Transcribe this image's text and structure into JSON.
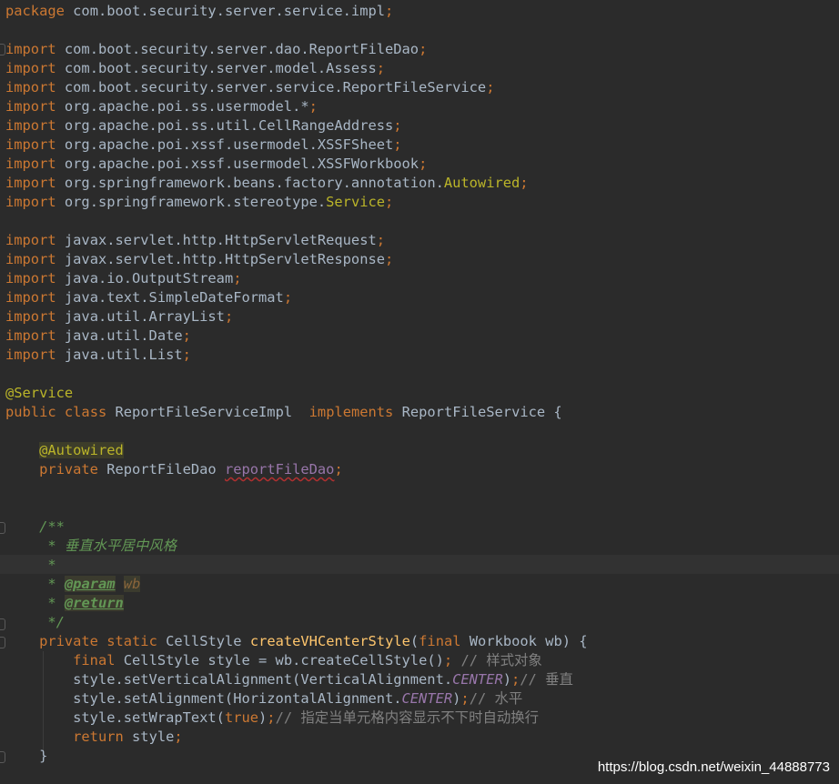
{
  "code": {
    "package_kw": "package",
    "package_name": "com.boot.security.server.service.impl",
    "semi": ";",
    "import_kw": "import",
    "imports_a": [
      {
        "path": "com.boot.security.server.dao.ReportFileDao",
        "tail": ""
      },
      {
        "path": "com.boot.security.server.model.Assess",
        "tail": ""
      },
      {
        "path": "com.boot.security.server.service.ReportFileService",
        "tail": ""
      },
      {
        "path": "org.apache.poi.ss.usermodel.*",
        "tail": ""
      },
      {
        "path": "org.apache.poi.ss.util.CellRangeAddress",
        "tail": ""
      },
      {
        "path": "org.apache.poi.xssf.usermodel.XSSFSheet",
        "tail": ""
      },
      {
        "path": "org.apache.poi.xssf.usermodel.XSSFWorkbook",
        "tail": ""
      },
      {
        "path": "org.springframework.beans.factory.annotation.",
        "tail": "Autowired"
      },
      {
        "path": "org.springframework.stereotype.",
        "tail": "Service"
      }
    ],
    "imports_b": [
      "javax.servlet.http.HttpServletRequest",
      "javax.servlet.http.HttpServletResponse",
      "java.io.OutputStream",
      "java.text.SimpleDateFormat",
      "java.util.ArrayList",
      "java.util.Date",
      "java.util.List"
    ],
    "service_annotation": "@Service",
    "public_kw": "public",
    "class_kw": "class",
    "class_name": "ReportFileServiceImpl",
    "implements_kw": "implements",
    "interface_name": "ReportFileService",
    "open_brace": "{",
    "autowired_annotation": "@Autowired",
    "private_kw": "private",
    "field_type": "ReportFileDao",
    "field_name": "reportFileDao",
    "javadoc_open": "/**",
    "javadoc_star": "*",
    "javadoc_desc": "垂直水平居中风格",
    "javadoc_param_tag": "@param",
    "javadoc_param_name": "wb",
    "javadoc_return_tag": "@return",
    "javadoc_close": "*/",
    "static_kw": "static",
    "return_type": "CellStyle",
    "method_name": "createVHCenterStyle",
    "final_kw": "final",
    "param_sig": "Workbook wb) {",
    "stmt1_code": "CellStyle style = wb.createCellStyle()",
    "stmt1_comment": "// 样式对象",
    "stmt2_code": "style.setVerticalAlignment(VerticalAlignment.",
    "stmt3_code": "style.setAlignment(HorizontalAlignment.",
    "center_const": "CENTER",
    "close_paren": ")",
    "stmt2_comment": "// 垂直",
    "stmt3_comment": "// 水平",
    "stmt4_code": "style.setWrapText(",
    "true_kw": "true",
    "stmt4_comment": "// 指定当单元格内容显示不下时自动换行",
    "return_kw": "return",
    "return_expr": "style",
    "close_brace": "}"
  },
  "watermark": "https://blog.csdn.net/weixin_44888773"
}
